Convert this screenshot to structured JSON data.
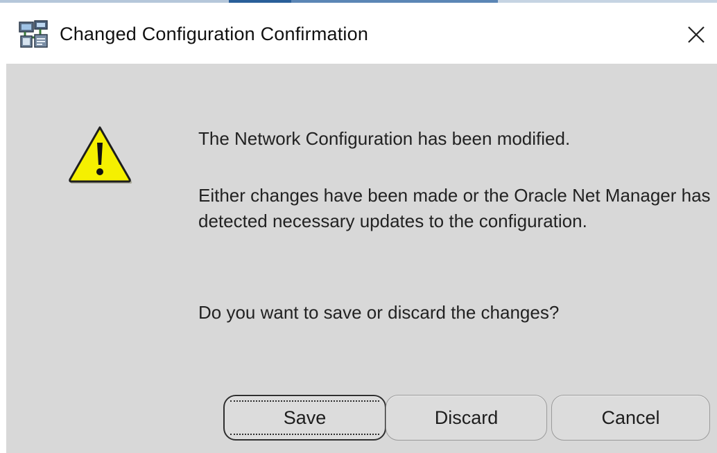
{
  "window": {
    "title": "Changed Configuration Confirmation"
  },
  "icons": {
    "app": "network-config-app-icon",
    "close": "close-icon",
    "warning": "warning-icon"
  },
  "message": {
    "line1": "The Network Configuration has been modified.",
    "line2": "Either changes have been made or the Oracle Net Manager has detected necessary updates to the configuration.",
    "line3": "Do you want to save or discard the changes?"
  },
  "buttons": {
    "save": "Save",
    "discard": "Discard",
    "cancel": "Cancel"
  },
  "colors": {
    "dialog_background": "#d8d8d8",
    "warning_yellow": "#f5f000",
    "taskbar_accent": "#2a5f99"
  }
}
